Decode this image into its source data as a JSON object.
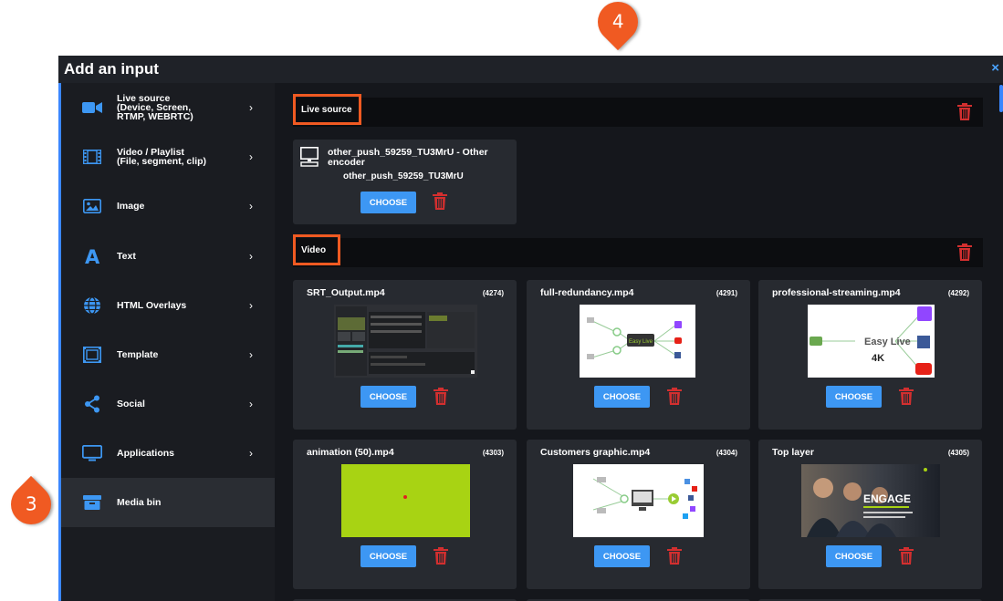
{
  "callouts": {
    "top": "4",
    "left": "3"
  },
  "dialog": {
    "title": "Add an input",
    "close": "×"
  },
  "sidebar": {
    "items": [
      {
        "label": "Live source\n(Device, Screen,\nRTMP, WEBRTC)",
        "icon": "video-camera-icon",
        "chevron": "›"
      },
      {
        "label": "Video / Playlist\n(File, segment, clip)",
        "icon": "film-icon",
        "chevron": "›"
      },
      {
        "label": "Image",
        "icon": "image-icon",
        "chevron": "›"
      },
      {
        "label": "Text",
        "icon": "text-icon",
        "chevron": "›"
      },
      {
        "label": "HTML Overlays",
        "icon": "globe-icon",
        "chevron": "›"
      },
      {
        "label": "Template",
        "icon": "template-icon",
        "chevron": "›"
      },
      {
        "label": "Social",
        "icon": "share-icon",
        "chevron": "›"
      },
      {
        "label": "Applications",
        "icon": "monitor-icon",
        "chevron": "›"
      },
      {
        "label": "Media bin",
        "icon": "archive-box-icon",
        "chevron": ""
      }
    ]
  },
  "live_section": {
    "title": "Live source",
    "card": {
      "name": "other_push_59259_TU3MrU - Other encoder",
      "sub": "other_push_59259_TU3MrU",
      "choose": "CHOOSE",
      "icon": "desktop-icon"
    }
  },
  "video_section": {
    "title": "Video",
    "cards": [
      {
        "name": "SRT_Output.mp4",
        "count": "(4274)",
        "choose": "CHOOSE"
      },
      {
        "name": "full-redundancy.mp4",
        "count": "(4291)",
        "choose": "CHOOSE",
        "thumb_text": "Easy Live"
      },
      {
        "name": "professional-streaming.mp4",
        "count": "(4292)",
        "choose": "CHOOSE",
        "thumb_text": "Easy Live",
        "thumb_text2": "4K"
      },
      {
        "name": "animation (50).mp4",
        "count": "(4303)",
        "choose": "CHOOSE"
      },
      {
        "name": "Customers graphic.mp4",
        "count": "(4304)",
        "choose": "CHOOSE"
      },
      {
        "name": "Top layer",
        "count": "(4305)",
        "choose": "CHOOSE",
        "thumb_text": "ENGAGE"
      }
    ]
  },
  "colors": {
    "accent": "#3d97f3",
    "callout": "#f05a22",
    "trash": "#d32f2f",
    "lime": "#a8d313"
  }
}
